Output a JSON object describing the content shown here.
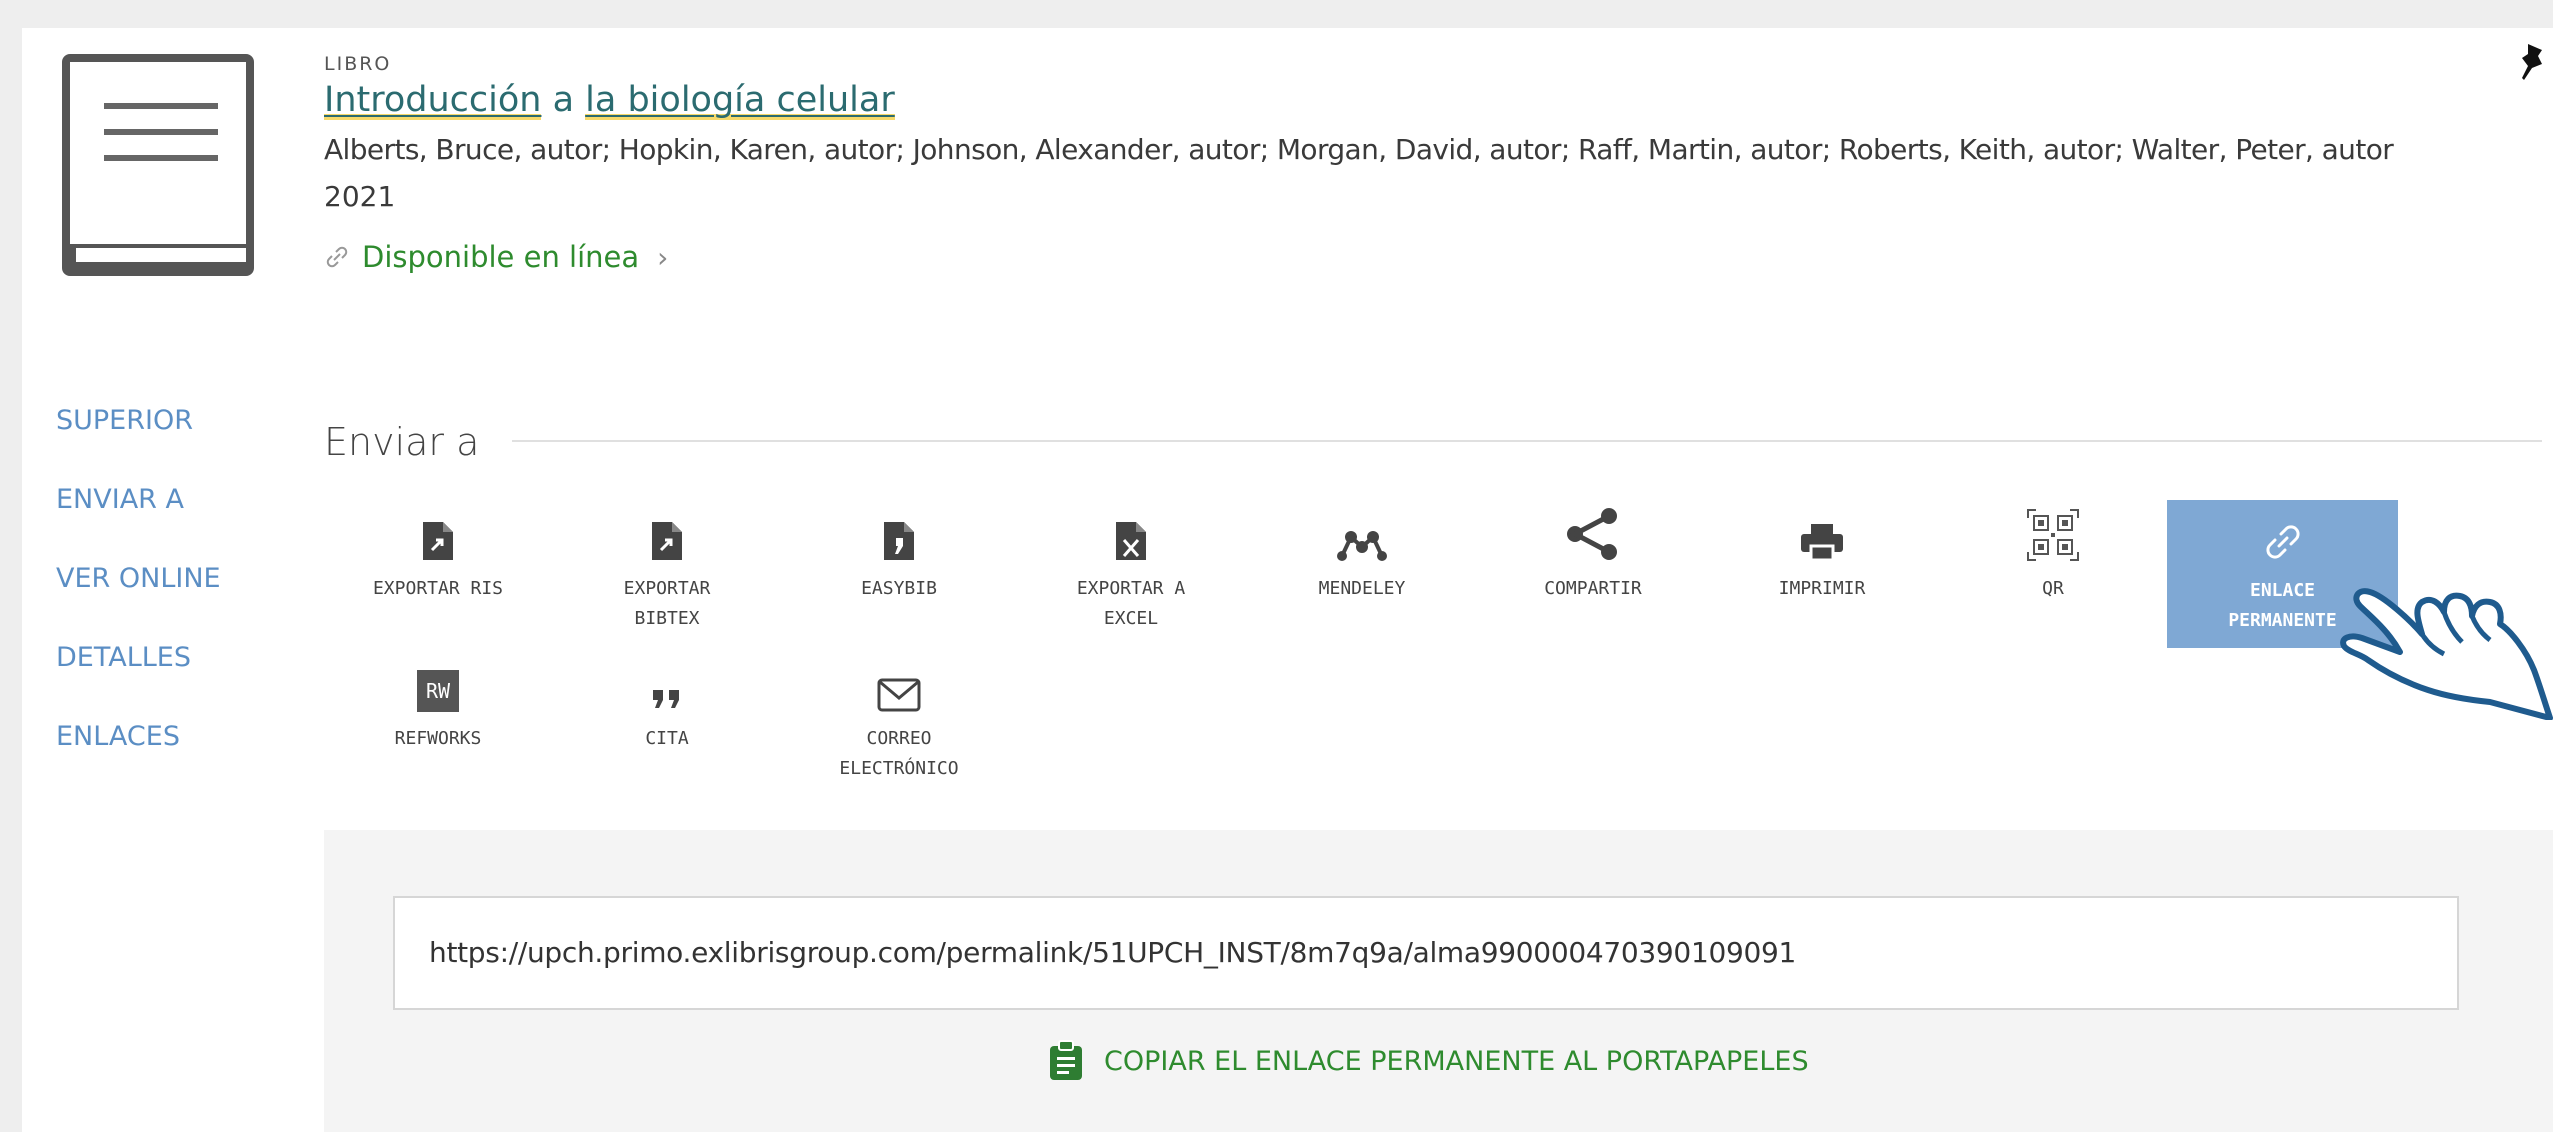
{
  "record": {
    "type": "LIBRO",
    "title_part1": "Introducción",
    "title_part2": " a ",
    "title_part3": "la biología celular",
    "authors": "Alberts, Bruce, autor; Hopkin, Karen, autor; Johnson, Alexander, autor; Morgan, David, autor; Raff, Martin, autor; Roberts, Keith, autor; Walter, Peter, autor",
    "year": "2021",
    "availability": "Disponible en línea"
  },
  "sidenav": {
    "items": [
      {
        "label": "SUPERIOR"
      },
      {
        "label": "ENVIAR A"
      },
      {
        "label": "VER ONLINE"
      },
      {
        "label": "DETALLES"
      },
      {
        "label": "ENLACES"
      }
    ]
  },
  "send_to": {
    "title": "Enviar a",
    "actions": [
      {
        "label": "EXPORTAR RIS",
        "icon": "file-export-icon"
      },
      {
        "label": "EXPORTAR\nBIBTEX",
        "icon": "file-export-icon"
      },
      {
        "label": "EASYBIB",
        "icon": "easybib-icon"
      },
      {
        "label": "EXPORTAR A\nEXCEL",
        "icon": "excel-file-icon"
      },
      {
        "label": "MENDELEY",
        "icon": "mendeley-icon"
      },
      {
        "label": "COMPARTIR",
        "icon": "share-icon"
      },
      {
        "label": "IMPRIMIR",
        "icon": "printer-icon"
      },
      {
        "label": "QR",
        "icon": "qr-code-icon"
      },
      {
        "label": "ENLACE\nPERMANENTE",
        "icon": "link-icon"
      },
      {
        "label": "REFWORKS",
        "icon": "refworks-icon"
      },
      {
        "label": "CITA",
        "icon": "quote-icon"
      },
      {
        "label": "CORREO\nELECTRÓNICO",
        "icon": "envelope-icon"
      }
    ],
    "refworks_badge": "RW"
  },
  "permalink": {
    "url": "https://upch.primo.exlibrisgroup.com/permalink/51UPCH_INST/8m7q9a/alma990000470390109091",
    "copy_label": "COPIAR EL ENLACE PERMANENTE AL PORTAPAPELES"
  },
  "colors": {
    "accent_link": "#5b8ec4",
    "available_green": "#2e8b2e",
    "permalink_active": "#7fa8d4",
    "title_teal": "#2b6b70"
  }
}
